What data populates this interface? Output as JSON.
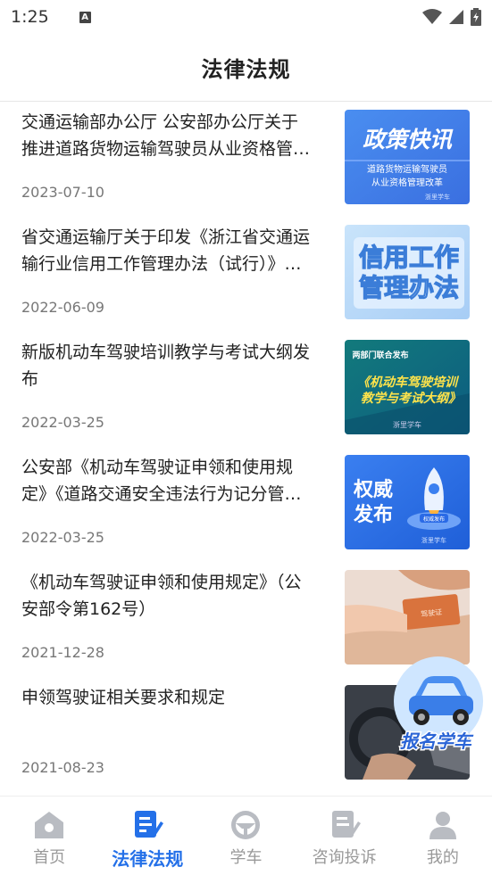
{
  "status_bar": {
    "time": "1:25",
    "indicator": "A"
  },
  "header": {
    "title": "法律法规"
  },
  "articles": [
    {
      "title": "交通运输部办公厅 公安部办公厅关于推进道路货物运输驾驶员从业资格管理改革",
      "date": "2023-07-10",
      "thumb": {
        "headline": "政策快讯",
        "line1": "道路货物运输驾驶员",
        "line2": "从业资格管理改革",
        "watermark": "浙里学车"
      }
    },
    {
      "title": "省交通运输厅关于印发《浙江省交通运输行业信用工作管理办法（试行）》的通知",
      "date": "2022-06-09",
      "thumb": {
        "line1": "信用工作",
        "line2": "管理办法"
      }
    },
    {
      "title": "新版机动车驾驶培训教学与考试大纲发布",
      "date": "2022-03-25",
      "thumb": {
        "top": "两部门联合发布",
        "line1": "《机动车驾驶培训",
        "line2": "教学与考试大纲》",
        "watermark": "浙里学车"
      }
    },
    {
      "title": "公安部《机动车驾驶证申领和使用规定》《道路交通安全违法行为记分管理办法》",
      "date": "2022-03-25",
      "thumb": {
        "line1": "权威",
        "line2": "发布",
        "badge": "权威发布",
        "watermark": "浙里学车"
      }
    },
    {
      "title": "《机动车驾驶证申领和使用规定》（公安部令第162号）",
      "date": "2021-12-28",
      "thumb": {
        "card": "驾驶证"
      }
    },
    {
      "title": "申领驾驶证相关要求和规定",
      "date": "2021-08-23",
      "thumb": {}
    }
  ],
  "float_button": {
    "label": "报名学车"
  },
  "tabbar": {
    "items": [
      {
        "label": "首页",
        "active": false
      },
      {
        "label": "法律法规",
        "active": true
      },
      {
        "label": "学车",
        "active": false
      },
      {
        "label": "咨询投诉",
        "active": false
      },
      {
        "label": "我的",
        "active": false
      }
    ]
  },
  "colors": {
    "accent": "#2470e8",
    "inactive": "#999999",
    "date": "#777777"
  }
}
